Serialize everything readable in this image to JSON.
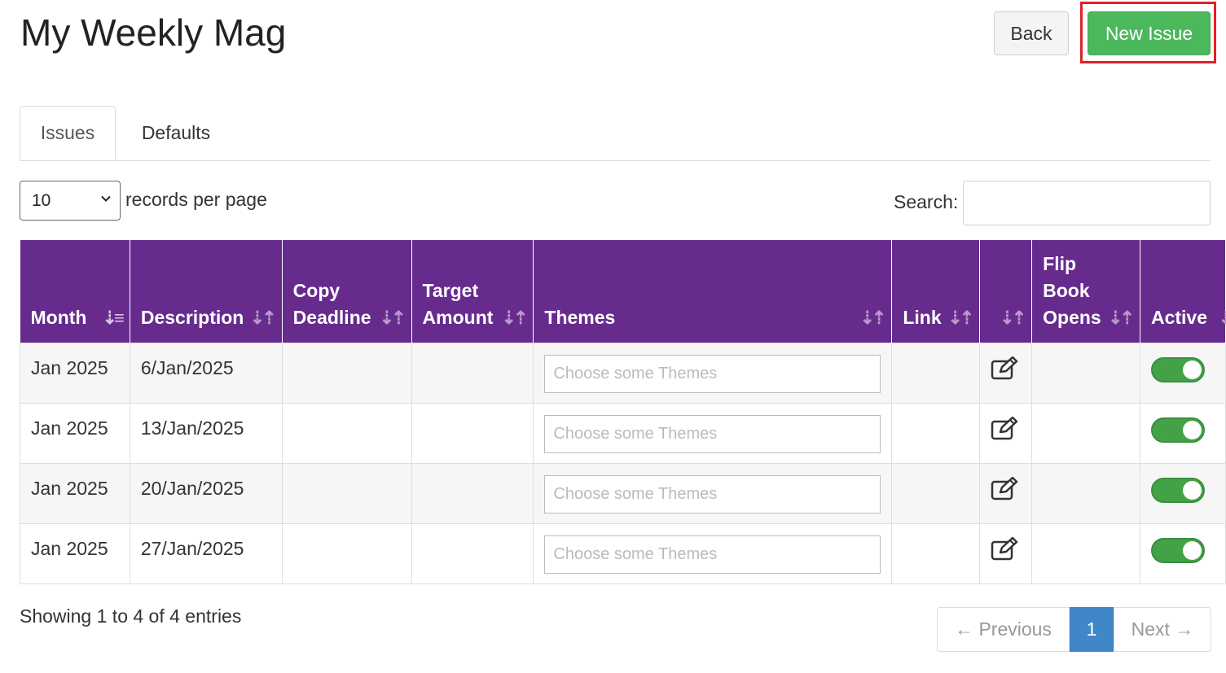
{
  "header": {
    "title": "My Weekly Mag",
    "back_label": "Back",
    "new_issue_label": "New Issue"
  },
  "tabs": [
    {
      "label": "Issues"
    },
    {
      "label": "Defaults"
    }
  ],
  "controls": {
    "page_length_value": "10",
    "page_length_label": "records per page",
    "search_label": "Search:",
    "search_value": ""
  },
  "table": {
    "columns": [
      "Month",
      "Description",
      "Copy Deadline",
      "Target Amount",
      "Themes",
      "Link",
      "",
      "Flip Book Opens",
      "Active"
    ],
    "rows": [
      {
        "month": "Jan 2025",
        "description": "6/Jan/2025",
        "copy_deadline": "",
        "target_amount": "",
        "themes_placeholder": "Choose some Themes",
        "link": "",
        "flip_book_opens": "",
        "active": true
      },
      {
        "month": "Jan 2025",
        "description": "13/Jan/2025",
        "copy_deadline": "",
        "target_amount": "",
        "themes_placeholder": "Choose some Themes",
        "link": "",
        "flip_book_opens": "",
        "active": true
      },
      {
        "month": "Jan 2025",
        "description": "20/Jan/2025",
        "copy_deadline": "",
        "target_amount": "",
        "themes_placeholder": "Choose some Themes",
        "link": "",
        "flip_book_opens": "",
        "active": true
      },
      {
        "month": "Jan 2025",
        "description": "27/Jan/2025",
        "copy_deadline": "",
        "target_amount": "",
        "themes_placeholder": "Choose some Themes",
        "link": "",
        "flip_book_opens": "",
        "active": true
      }
    ]
  },
  "footer": {
    "info": "Showing 1 to 4 of 4 entries",
    "previous_label": "← Previous",
    "page_label": "1",
    "next_label": "Next →"
  },
  "colors": {
    "header_bg": "#672b8e",
    "new_issue_bg": "#4cb85c",
    "highlight": "#e0202a",
    "active_page": "#3f87c8",
    "toggle_on": "#43a247"
  }
}
